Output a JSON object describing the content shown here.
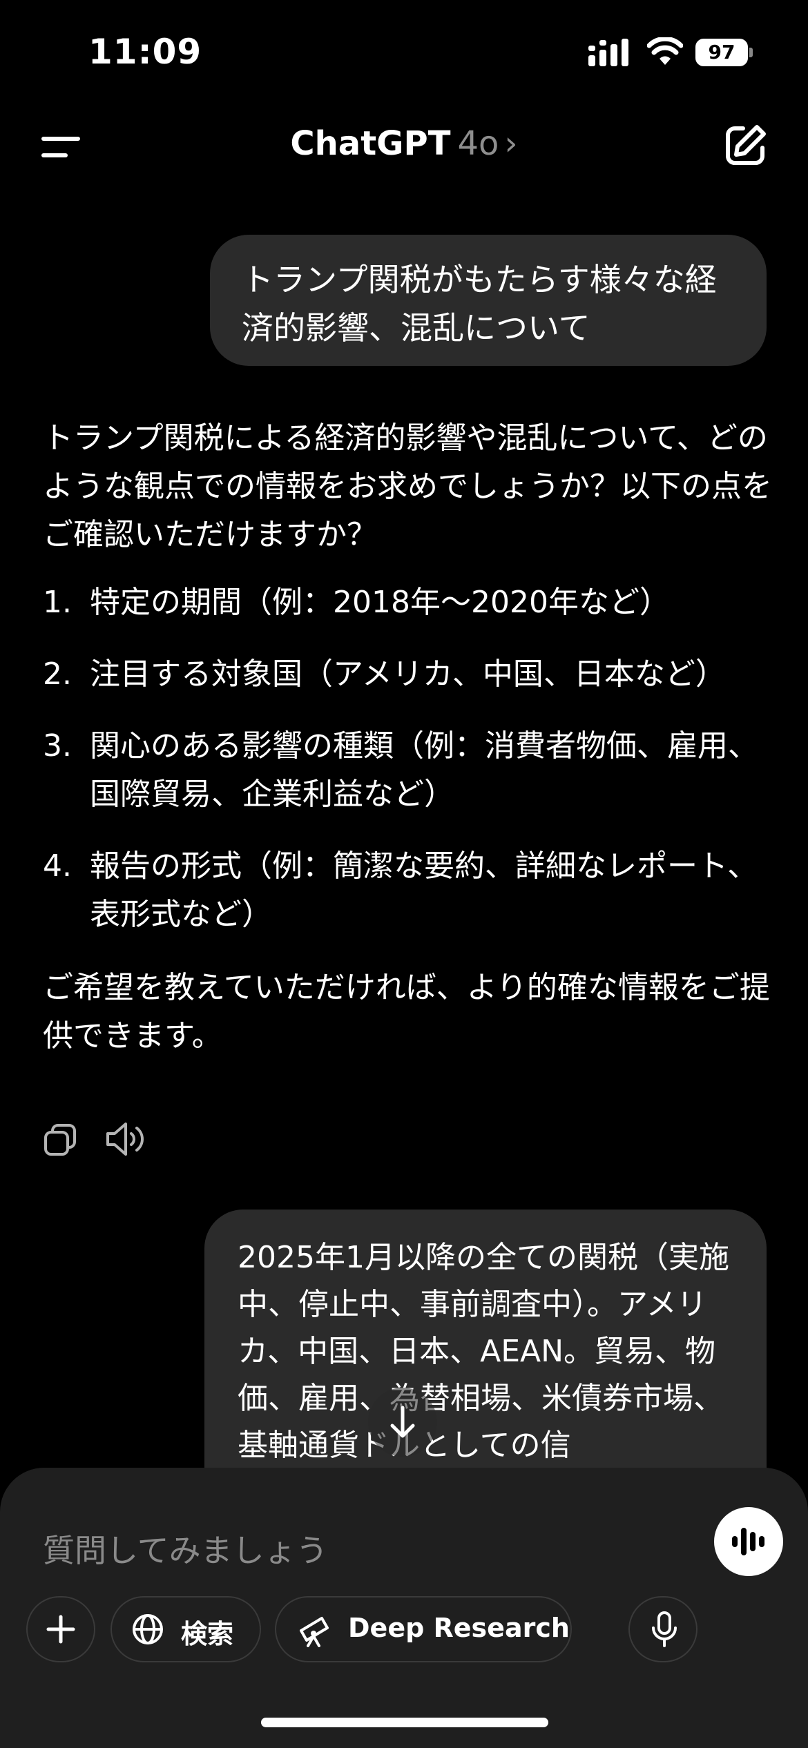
{
  "status_bar": {
    "time": "11:09",
    "battery": "97"
  },
  "nav": {
    "title": "ChatGPT",
    "model": "4o",
    "chevron": "›"
  },
  "messages": {
    "user_1": "トランプ関税がもたらす様々な経済的影響、混乱について",
    "assistant_1": {
      "intro": "トランプ関税による経済的影響や混乱について、どのような観点での情報をお求めでしょうか？以下の点をご確認いただけますか？",
      "items": [
        {
          "num": "1.",
          "text": "特定の期間（例：2018年〜2020年など）"
        },
        {
          "num": "2.",
          "text": "注目する対象国（アメリカ、中国、日本など）"
        },
        {
          "num": "3.",
          "text": "関心のある影響の種類（例：消費者物価、雇用、国際貿易、企業利益など）"
        },
        {
          "num": "4.",
          "text": "報告の形式（例：簡潔な要約、詳細なレポート、表形式など）"
        }
      ],
      "outro": "ご希望を教えていただければ、より的確な情報をご提供できます。"
    },
    "user_2": "2025年1月以降の全ての関税（実施中、停止中、事前調査中）。アメリカ、中国、日本、AEAN。貿易、物価、雇用、為替相場、米債券市場、基軸通貨ドルとしての信"
  },
  "composer": {
    "placeholder": "質問してみましょう",
    "search_label": "検索",
    "research_label": "Deep Research"
  },
  "icons": {
    "menu": "menu-icon",
    "new_chat": "edit-icon",
    "copy": "copy-icon",
    "speaker": "speaker-icon",
    "scroll": "arrow-down-icon",
    "plus": "plus-icon",
    "globe": "globe-icon",
    "telescope": "telescope-icon",
    "mic": "microphone-icon",
    "voice": "voice-waveform-icon"
  },
  "colors": {
    "background": "#000000",
    "bubble": "#2b2b2b",
    "composer": "#1f1f1f",
    "muted_text": "#8e8e8e"
  }
}
